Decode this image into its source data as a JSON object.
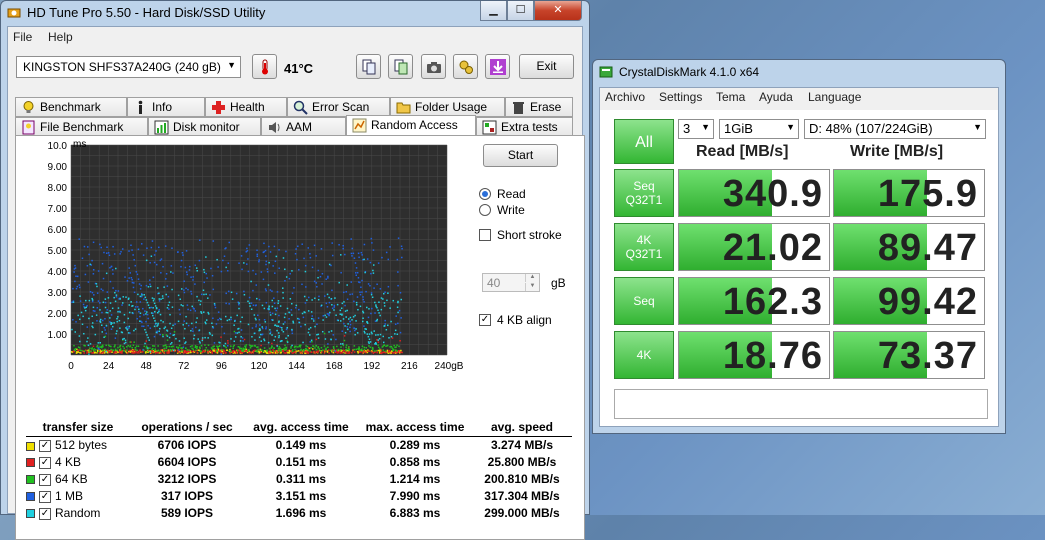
{
  "hdtune": {
    "title": "HD Tune Pro 5.50 - Hard Disk/SSD Utility",
    "menu": [
      "File",
      "Help"
    ],
    "drive": "KINGSTON SHFS37A240G (240 gB)",
    "temperature": "41°C",
    "exit_label": "Exit",
    "tabs_row1": [
      "Benchmark",
      "Info",
      "Health",
      "Error Scan",
      "Folder Usage",
      "Erase"
    ],
    "tabs_row2": [
      "File Benchmark",
      "Disk monitor",
      "AAM",
      "Random Access",
      "Extra tests"
    ],
    "active_tab": "Random Access",
    "start_label": "Start",
    "read_label": "Read",
    "write_label": "Write",
    "short_stroke_label": "Short stroke",
    "short_stroke_value": "40",
    "gb_unit": "gB",
    "align_label": "4 KB align",
    "table": {
      "headers": [
        "transfer size",
        "operations / sec",
        "avg. access time",
        "max. access time",
        "avg. speed"
      ],
      "rows": [
        {
          "name": "512 bytes",
          "color": "#f0e000",
          "ops": "6706 IOPS",
          "avg": "0.149 ms",
          "max": "0.289 ms",
          "speed": "3.274 MB/s"
        },
        {
          "name": "4 KB",
          "color": "#e02020",
          "ops": "6604 IOPS",
          "avg": "0.151 ms",
          "max": "0.858 ms",
          "speed": "25.800 MB/s"
        },
        {
          "name": "64 KB",
          "color": "#20c020",
          "ops": "3212 IOPS",
          "avg": "0.311 ms",
          "max": "1.214 ms",
          "speed": "200.810 MB/s"
        },
        {
          "name": "1 MB",
          "color": "#2060e0",
          "ops": "317 IOPS",
          "avg": "3.151 ms",
          "max": "7.990 ms",
          "speed": "317.304 MB/s"
        },
        {
          "name": "Random",
          "color": "#20d0e0",
          "ops": "589 IOPS",
          "avg": "1.696 ms",
          "max": "6.883 ms",
          "speed": "299.000 MB/s"
        }
      ]
    }
  },
  "chart_data": {
    "type": "scatter",
    "ylabel": "ms",
    "xlabel": "",
    "xticks": [
      "0",
      "24",
      "48",
      "72",
      "96",
      "120",
      "144",
      "168",
      "192",
      "216",
      "240gB"
    ],
    "yticks": [
      "1.00",
      "2.00",
      "3.00",
      "4.00",
      "5.00",
      "6.00",
      "7.00",
      "8.00",
      "9.00",
      "10.0"
    ],
    "xlim": [
      0,
      240
    ],
    "ylim": [
      0,
      10
    ],
    "grid": true,
    "series": [
      {
        "name": "512 bytes",
        "color": "#f0e000",
        "avg_ms": 0.149,
        "max_ms": 0.289
      },
      {
        "name": "4 KB",
        "color": "#e02020",
        "avg_ms": 0.151,
        "max_ms": 0.858
      },
      {
        "name": "64 KB",
        "color": "#20c020",
        "avg_ms": 0.311,
        "max_ms": 1.214
      },
      {
        "name": "1 MB",
        "color": "#2060e0",
        "avg_ms": 3.151,
        "max_ms": 7.99
      },
      {
        "name": "Random",
        "color": "#20d0e0",
        "avg_ms": 1.696,
        "max_ms": 6.883
      }
    ]
  },
  "cdm": {
    "title": "CrystalDiskMark 4.1.0 x64",
    "menu": [
      "Archivo",
      "Settings",
      "Tema",
      "Ayuda",
      "Language"
    ],
    "all_label": "All",
    "count": "3",
    "size": "1GiB",
    "drive": "D: 48% (107/224GiB)",
    "read_header": "Read [MB/s]",
    "write_header": "Write [MB/s]",
    "rows": [
      {
        "label1": "Seq",
        "label2": "Q32T1",
        "read": "340.9",
        "write": "175.9",
        "read_fill": 0.62,
        "write_fill": 0.62
      },
      {
        "label1": "4K",
        "label2": "Q32T1",
        "read": "21.02",
        "write": "89.47",
        "read_fill": 0.62,
        "write_fill": 0.62
      },
      {
        "label1": "Seq",
        "label2": "",
        "read": "162.3",
        "write": "99.42",
        "read_fill": 0.62,
        "write_fill": 0.62
      },
      {
        "label1": "4K",
        "label2": "",
        "read": "18.76",
        "write": "73.37",
        "read_fill": 0.62,
        "write_fill": 0.62
      }
    ],
    "comment": ""
  }
}
